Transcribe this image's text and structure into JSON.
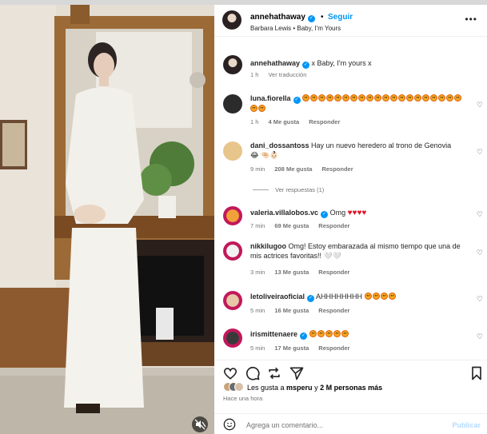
{
  "colors": {
    "accent": "#0095f6",
    "meta": "#737373",
    "heart_red": "#e0142a"
  },
  "post": {
    "username": "annehathaway",
    "dot": "•",
    "follow_label": "Seguir",
    "song": "Barbara Lewis • Baby, I'm Yours",
    "more_icon": "more-icon",
    "caption": "x Baby, I'm yours x",
    "caption_time": "1 h",
    "see_translation": "Ver traducción"
  },
  "comments": [
    {
      "user": "luna.fiorella",
      "text": "",
      "emoji_count": 22,
      "time": "1 h",
      "likes": "4 Me gusta",
      "reply": "Responder",
      "verified": true
    },
    {
      "user": "dani_dossantoss",
      "text": "Hay un nuevo heredero al trono de Genovia",
      "extra": "😂 🤏🏻👶🏻",
      "time": "9 min",
      "likes": "208 Me gusta",
      "reply": "Responder",
      "view_replies": "Ver respuestas (1)"
    },
    {
      "user": "valeria.villalobos.vc",
      "text": "Omg",
      "hearts": "♥♥♥♥",
      "time": "7 min",
      "likes": "69 Me gusta",
      "reply": "Responder",
      "verified": true
    },
    {
      "user": "nikkilugoo",
      "text": "Omg! Estoy embarazada al mismo tiempo que una de mis actrices favoritas!! 🤍🤍",
      "time": "3 min",
      "likes": "13 Me gusta",
      "reply": "Responder"
    },
    {
      "user": "letoliveiraoficial",
      "text": "AHHHHHHHH",
      "emoji_count": 4,
      "time": "5 min",
      "likes": "16 Me gusta",
      "reply": "Responder",
      "verified": true
    },
    {
      "user": "irismittenaere",
      "text": "",
      "emoji_count": 5,
      "time": "5 min",
      "likes": "17 Me gusta",
      "reply": "Responder",
      "verified": true
    }
  ],
  "likes_text_prefix": "Les gusta a ",
  "likes_user": "msperu",
  "likes_text_mid": " y ",
  "likes_count": "2 M personas más",
  "posted_ago": "Hace una hora",
  "add_comment_placeholder": "Agrega un comentario...",
  "publish_label": "Publicar",
  "topstrip_text": "· · · · · · · · · · · · · · ·"
}
